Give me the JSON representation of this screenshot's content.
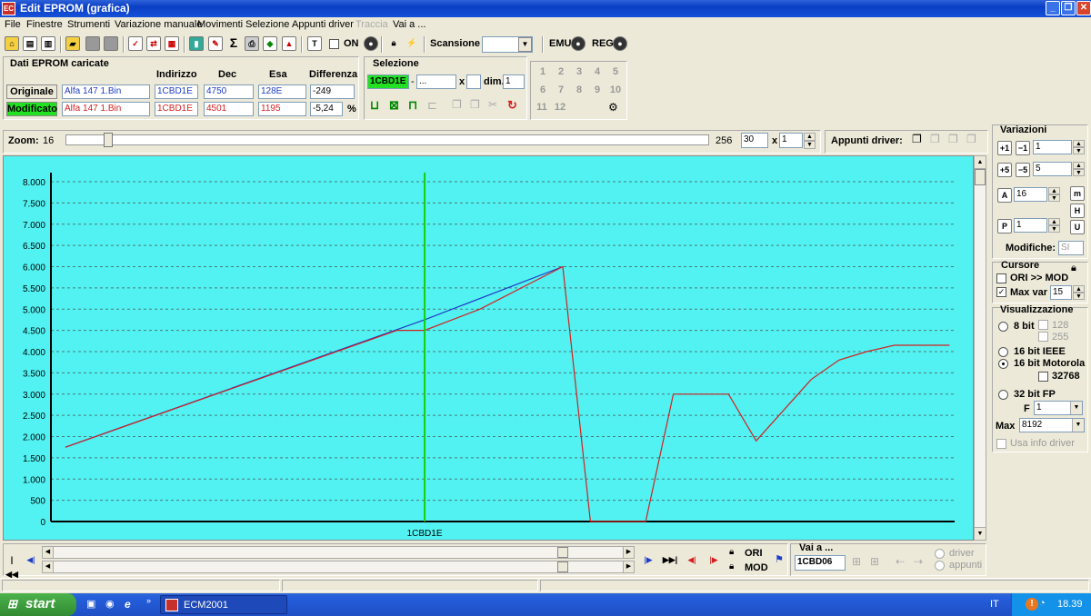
{
  "window": {
    "title": "Edit EPROM (grafica)",
    "app_icon": "ecm-app-icon"
  },
  "menu": [
    "File",
    "Finestre",
    "Strumenti",
    "Variazione manuale",
    "Movimenti",
    "Selezione",
    "Appunti driver",
    "Traccia",
    "Vai a ..."
  ],
  "toolbar": {
    "on_label": "ON",
    "scansione_label": "Scansione",
    "scansione_value": "",
    "emu_label": "EMU",
    "reg_label": "REG"
  },
  "eprom": {
    "title": "Dati EPROM caricate",
    "headers": {
      "indirizzo": "Indirizzo",
      "dec": "Dec",
      "esa": "Esa",
      "differenza": "Differenza"
    },
    "originale": {
      "label": "Originale",
      "file": "Alfa 147 1.Bin",
      "indirizzo": "1CBD1E",
      "dec": "4750",
      "esa": "128E",
      "diff": "-249"
    },
    "modificato": {
      "label": "Modificato",
      "file": "Alfa 147 1.Bin",
      "indirizzo": "1CBD1E",
      "dec": "4501",
      "esa": "1195",
      "diff": "-5,24",
      "unit": "%"
    }
  },
  "selezione": {
    "title": "Selezione",
    "start": "1CBD1E",
    "end": "...",
    "x_label": "x",
    "x_value": "",
    "dim_label": "dim.",
    "dim_value": "1"
  },
  "numpad": [
    "1",
    "2",
    "3",
    "4",
    "5",
    "6",
    "7",
    "8",
    "9",
    "10",
    "11",
    "12"
  ],
  "zoom": {
    "label": "Zoom:",
    "min": "16",
    "max": "256",
    "value": "30",
    "x_label": "x",
    "mult": "1",
    "level": 0.06
  },
  "appunti_driver": {
    "label": "Appunti driver:"
  },
  "variazioni": {
    "title": "Variazioni",
    "v1": "1",
    "v2": "5",
    "a_value": "16",
    "p_value": "1",
    "modifiche_label": "Modifiche:",
    "modifiche_value": "SI"
  },
  "cursore": {
    "title": "Cursore",
    "ori_mod": "ORI >> MOD",
    "max_var_label": "Max var",
    "max_var_value": "15"
  },
  "visual": {
    "title": "Visualizzazione",
    "bit8": "8 bit",
    "v128": "128",
    "v255": "255",
    "ieee": "16 bit IEEE",
    "motorola": "16 bit Motorola",
    "v32768": "32768",
    "fp32": "32 bit FP",
    "f_label": "F",
    "f_value": "1",
    "max_label": "Max",
    "max_value": "8192",
    "usa_info": "Usa info driver"
  },
  "bottom": {
    "ori": "ORI",
    "mod": "MOD",
    "vai_a": "Vai a ...",
    "vai_value": "1CBD06",
    "driver": "driver",
    "appunti": "appunti"
  },
  "taskbar": {
    "start": "start",
    "task": "ECM2001",
    "lang": "IT",
    "clock": "18.39"
  },
  "colors": {
    "chart_bg": "#52F2F2",
    "original_line": "#1E3CC8",
    "modified_line": "#D22020",
    "cursor": "#10D010",
    "modificato_btn": "#22E022"
  },
  "chart_data": {
    "type": "line",
    "ylim": [
      0,
      8000
    ],
    "yticks": [
      "0",
      "500",
      "1.000",
      "1.500",
      "2.000",
      "2.500",
      "3.000",
      "3.500",
      "4.000",
      "4.500",
      "5.000",
      "5.500",
      "6.000",
      "6.500",
      "7.000",
      "7.500",
      "8.000"
    ],
    "x_label": "1CBD1E",
    "cursor_index": 13,
    "grid": true,
    "series": [
      {
        "key": "original",
        "values": [
          1750,
          null,
          null,
          null,
          null,
          null,
          null,
          null,
          null,
          null,
          null,
          null,
          null,
          4750,
          null,
          null,
          null,
          null,
          6000
        ]
      },
      {
        "key": "modified",
        "values": [
          1750,
          null,
          null,
          null,
          null,
          null,
          null,
          null,
          null,
          null,
          null,
          null,
          4501,
          4501,
          null,
          5000,
          null,
          null,
          6000,
          0,
          null,
          0,
          3000,
          null,
          3000,
          1900,
          null,
          3350,
          3800,
          4000,
          4150,
          null,
          4150
        ]
      }
    ]
  }
}
